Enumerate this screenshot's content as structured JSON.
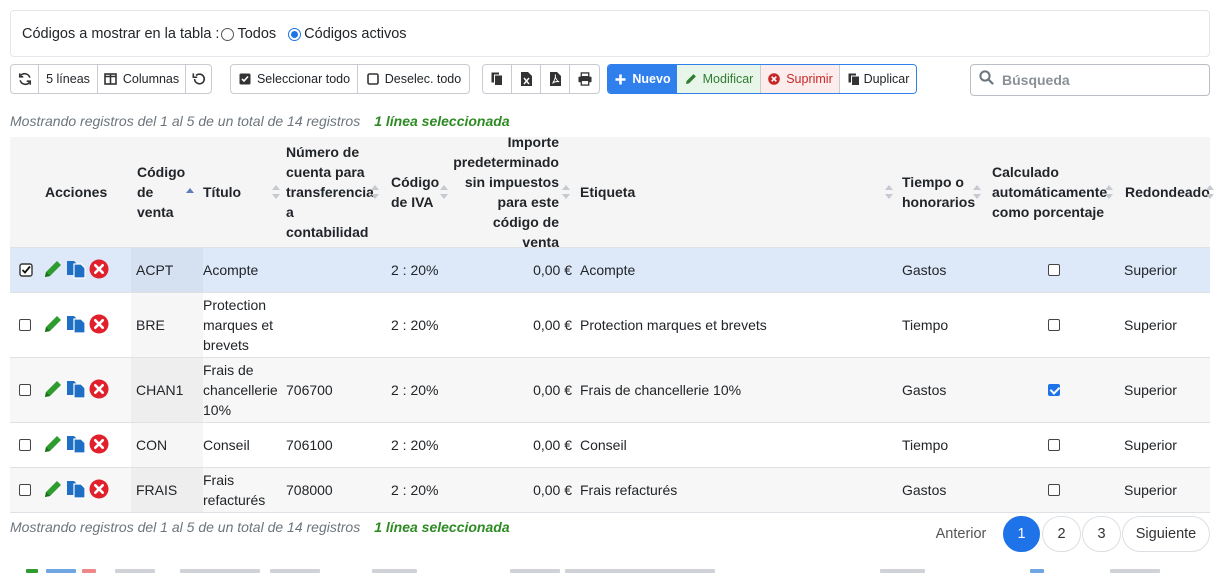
{
  "filter": {
    "label": "Códigos a mostrar en la tabla :",
    "options": [
      "Todos",
      "Códigos activos"
    ],
    "selected": "Códigos activos"
  },
  "toolbar": {
    "lines_label": "5 líneas",
    "columns_label": "Columnas",
    "select_all_label": "Seleccionar todo",
    "deselect_all_label": "Deselec. todo",
    "new_label": "Nuevo",
    "modify_label": "Modificar",
    "delete_label": "Suprimir",
    "duplicate_label": "Duplicar"
  },
  "search": {
    "placeholder": "Búsqueda"
  },
  "info": {
    "records": "Mostrando registros del 1 al 5 de un total de 14 registros",
    "selected": "1 línea seleccionada"
  },
  "table": {
    "headers": {
      "actions": "Acciones",
      "code": [
        "Código",
        "de",
        "venta"
      ],
      "title": "Título",
      "account": [
        "Número de",
        "cuenta para",
        "transferencia",
        "a",
        "contabilidad"
      ],
      "vat": [
        "Código",
        "de IVA"
      ],
      "amount": [
        "Importe",
        "predeterminado",
        "sin impuestos",
        "para este",
        "código de venta"
      ],
      "label": "Etiqueta",
      "time": [
        "Tiempo o",
        "honorarios"
      ],
      "percent": [
        "Calculado",
        "automáticamente",
        "como porcentaje"
      ],
      "rounded": "Redondeado"
    },
    "rows": [
      {
        "selected": true,
        "code": "ACPT",
        "title": "Acompte",
        "account": "",
        "vat": "2 : 20%",
        "amount": "0,00 €",
        "label": "Acompte",
        "time": "Gastos",
        "percent": false,
        "rounded": "Superior"
      },
      {
        "selected": false,
        "code": "BRE",
        "title": "Protection marques et brevets",
        "account": "",
        "vat": "2 : 20%",
        "amount": "0,00 €",
        "label": "Protection marques et brevets",
        "time": "Tiempo",
        "percent": false,
        "rounded": "Superior"
      },
      {
        "selected": false,
        "code": "CHAN1",
        "title": "Frais de chancellerie 10%",
        "account": "706700",
        "vat": "2 : 20%",
        "amount": "0,00 €",
        "label": "Frais de chancellerie 10%",
        "time": "Gastos",
        "percent": true,
        "rounded": "Superior"
      },
      {
        "selected": false,
        "code": "CON",
        "title": "Conseil",
        "account": "706100",
        "vat": "2 : 20%",
        "amount": "0,00 €",
        "label": "Conseil",
        "time": "Tiempo",
        "percent": false,
        "rounded": "Superior"
      },
      {
        "selected": false,
        "code": "FRAIS",
        "title": "Frais refacturés",
        "account": "708000",
        "vat": "2 : 20%",
        "amount": "0,00 €",
        "label": "Frais refacturés",
        "time": "Gastos",
        "percent": false,
        "rounded": "Superior"
      }
    ]
  },
  "pagination": {
    "previous": "Anterior",
    "pages": [
      "1",
      "2",
      "3"
    ],
    "current": "1",
    "next": "Siguiente"
  },
  "colors": {
    "primary": "#2f80ed",
    "edit_green": "#2e9c2e",
    "delete_red": "#e0202a",
    "copy_blue": "#1f6fc5",
    "selected_row": "#dde9f9"
  }
}
